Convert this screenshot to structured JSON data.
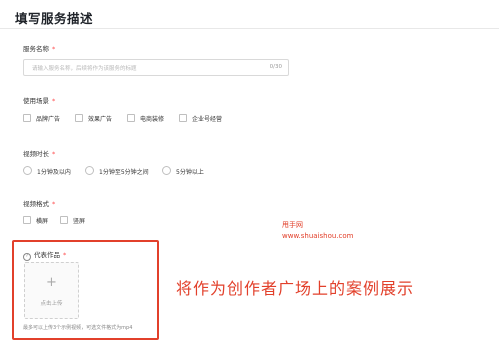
{
  "header": {
    "title": "填写服务描述"
  },
  "service_name": {
    "label": "服务名称",
    "required_mark": "*",
    "placeholder": "请输入服务名称，后续将作为该服务的标题",
    "count": "0/30"
  },
  "usage_scene": {
    "label": "使用场景",
    "required_mark": "*",
    "options": [
      "品牌广告",
      "效果广告",
      "电商装修",
      "企业号经营"
    ]
  },
  "video_length": {
    "label": "视频时长",
    "required_mark": "*",
    "options": [
      "1分钟及以内",
      "1分钟至5分钟之间",
      "5分钟以上"
    ]
  },
  "video_format": {
    "label": "视频格式",
    "required_mark": "*",
    "options": [
      "横屏",
      "竖屏"
    ]
  },
  "representative_works": {
    "label": "代表作品",
    "required_mark": "*",
    "help_icon": "question-circle-icon",
    "upload_icon": "plus-icon",
    "upload_plus": "+",
    "upload_label": "点击上传",
    "hint": "最多可以上传3个示例视频，可选文件格式为mp4"
  },
  "watermark": {
    "line1": "甩手网",
    "line2": "www.shuaishou.com"
  },
  "annotation": {
    "text": "将作为创作者广场上的案例展示"
  },
  "colors": {
    "accent_red": "#e2402b",
    "required_red": "#ff4d4f"
  }
}
